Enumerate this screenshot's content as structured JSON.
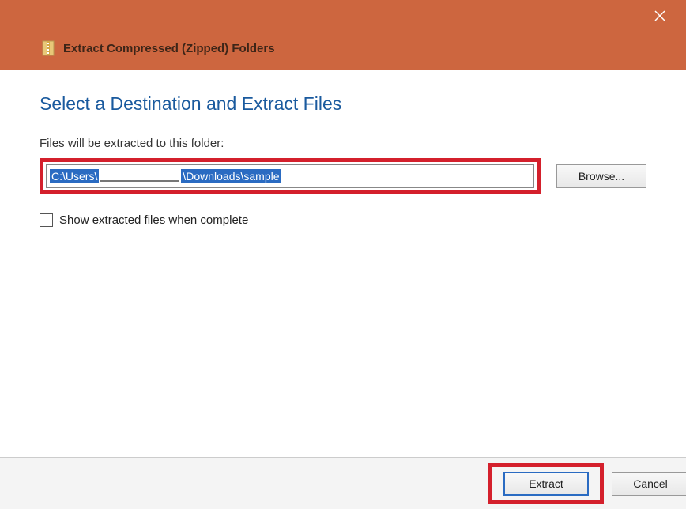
{
  "window": {
    "title": "Extract Compressed (Zipped) Folders"
  },
  "main": {
    "heading": "Select a Destination and Extract Files",
    "path_label": "Files will be extracted to this folder:",
    "path_prefix": "C:\\Users\\",
    "path_suffix": "\\Downloads\\sample",
    "browse_label": "Browse...",
    "checkbox_label": "Show extracted files when complete",
    "checkbox_checked": false
  },
  "footer": {
    "extract_label": "Extract",
    "cancel_label": "Cancel"
  }
}
